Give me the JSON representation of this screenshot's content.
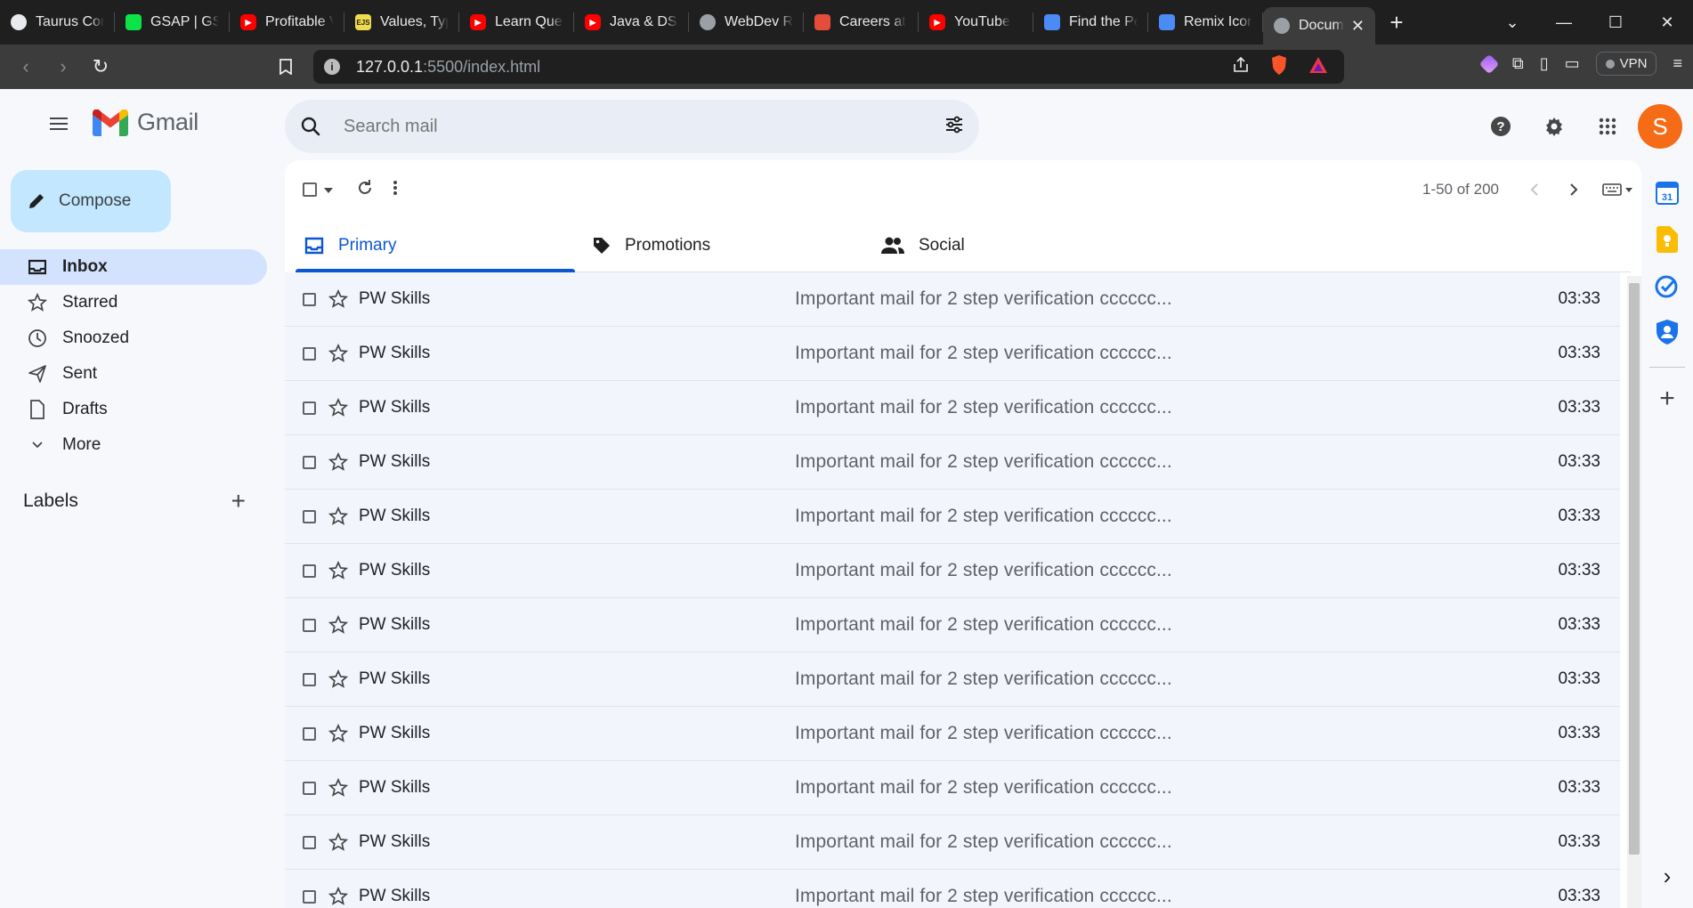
{
  "browser": {
    "tabs": [
      {
        "title": "Taurus Com",
        "favicon": "taurus-icon",
        "color": "#e8eaed"
      },
      {
        "title": "GSAP | GSA",
        "favicon": "gsap-icon",
        "color": "#0ae448"
      },
      {
        "title": "Profitable V",
        "favicon": "youtube-icon",
        "color": "#ff0000"
      },
      {
        "title": "Values, Typ",
        "favicon": "js-icon",
        "color": "#f0db4f"
      },
      {
        "title": "Learn Queu",
        "favicon": "youtube-icon",
        "color": "#ff0000"
      },
      {
        "title": "Java & DSA",
        "favicon": "youtube-icon",
        "color": "#ff0000"
      },
      {
        "title": "WebDev Ro",
        "favicon": "globe-icon",
        "color": "#9aa0a6"
      },
      {
        "title": "Careers at",
        "favicon": "careers-icon",
        "color": "#e44d3a"
      },
      {
        "title": "YouTube",
        "favicon": "youtube-icon",
        "color": "#ff0000"
      },
      {
        "title": "Find the Pe",
        "favicon": "flag-icon",
        "color": "#4c8bf5"
      },
      {
        "title": "Remix Icon",
        "favicon": "remix-icon",
        "color": "#4c8bf5"
      }
    ],
    "active_tab": {
      "title": "Docum",
      "close": "✕"
    },
    "new_tab": "+",
    "url_host": "127.0.0.1",
    "url_rest": ":5500/index.html",
    "vpn_label": "VPN"
  },
  "gmail": {
    "brand": "Gmail",
    "search_placeholder": "Search mail",
    "avatar_letter": "S",
    "compose_label": "Compose",
    "nav": [
      {
        "label": "Inbox",
        "icon": "inbox-icon",
        "active": true
      },
      {
        "label": "Starred",
        "icon": "star-icon",
        "active": false
      },
      {
        "label": "Snoozed",
        "icon": "clock-icon",
        "active": false
      },
      {
        "label": "Sent",
        "icon": "send-icon",
        "active": false
      },
      {
        "label": "Drafts",
        "icon": "draft-icon",
        "active": false
      },
      {
        "label": "More",
        "icon": "chevron-down-icon",
        "active": false
      }
    ],
    "labels_title": "Labels",
    "pager_text": "1-50 of 200",
    "categories": [
      {
        "label": "Primary",
        "icon": "inbox-icon",
        "active": true
      },
      {
        "label": "Promotions",
        "icon": "tag-icon",
        "active": false
      },
      {
        "label": "Social",
        "icon": "people-icon",
        "active": false
      }
    ],
    "emails": [
      {
        "sender": "PW Skills",
        "subject": "Important mail for 2 step verification cccccc...",
        "time": "03:33"
      },
      {
        "sender": "PW Skills",
        "subject": "Important mail for 2 step verification cccccc...",
        "time": "03:33"
      },
      {
        "sender": "PW Skills",
        "subject": "Important mail for 2 step verification cccccc...",
        "time": "03:33"
      },
      {
        "sender": "PW Skills",
        "subject": "Important mail for 2 step verification cccccc...",
        "time": "03:33"
      },
      {
        "sender": "PW Skills",
        "subject": "Important mail for 2 step verification cccccc...",
        "time": "03:33"
      },
      {
        "sender": "PW Skills",
        "subject": "Important mail for 2 step verification cccccc...",
        "time": "03:33"
      },
      {
        "sender": "PW Skills",
        "subject": "Important mail for 2 step verification cccccc...",
        "time": "03:33"
      },
      {
        "sender": "PW Skills",
        "subject": "Important mail for 2 step verification cccccc...",
        "time": "03:33"
      },
      {
        "sender": "PW Skills",
        "subject": "Important mail for 2 step verification cccccc...",
        "time": "03:33"
      },
      {
        "sender": "PW Skills",
        "subject": "Important mail for 2 step verification cccccc...",
        "time": "03:33"
      },
      {
        "sender": "PW Skills",
        "subject": "Important mail for 2 step verification cccccc...",
        "time": "03:33"
      },
      {
        "sender": "PW Skills",
        "subject": "Important mail for 2 step verification cccccc...",
        "time": "03:33"
      }
    ],
    "side_apps": [
      {
        "name": "calendar-icon",
        "color": "#1a73e8"
      },
      {
        "name": "keep-icon",
        "color": "#fbbc04"
      },
      {
        "name": "tasks-icon",
        "color": "#1a73e8"
      },
      {
        "name": "contacts-icon",
        "color": "#1a73e8"
      }
    ],
    "colors": {
      "accent": "#0b57d0",
      "compose_bg": "#c2e7ff",
      "nav_active_bg": "#d3e3fd",
      "avatar_bg": "#f56b16"
    }
  }
}
